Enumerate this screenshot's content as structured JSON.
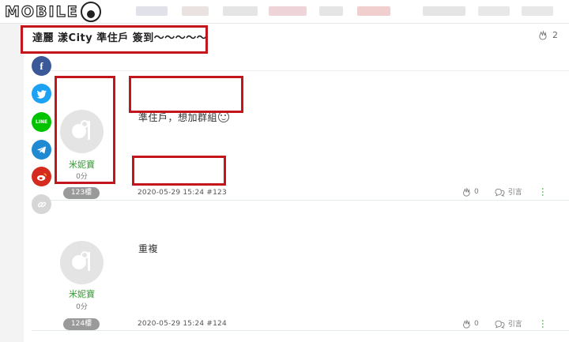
{
  "site": {
    "logo_text": "MOBILE"
  },
  "thread": {
    "title": "達麗 漾City 準住戶 簽到～～～～～",
    "like_count": "2"
  },
  "share_buttons": [
    {
      "name": "facebook",
      "glyph": "f",
      "color": "#3b5998"
    },
    {
      "name": "twitter",
      "glyph": "t",
      "color": "#1da1f2"
    },
    {
      "name": "line",
      "glyph": "LINE",
      "color": "#00c300"
    },
    {
      "name": "telegram",
      "glyph": "➤",
      "color": "#1f8ad1"
    },
    {
      "name": "weibo",
      "glyph": "w",
      "color": "#d52b1e"
    },
    {
      "name": "copy-link",
      "glyph": "∞",
      "color": "#d6d6d6"
    }
  ],
  "posts": [
    {
      "author": "米妮寶",
      "score": "0分",
      "floor": "123樓",
      "content": "準住戶，想加群組",
      "meta": "2020-05-29 15:24 #123",
      "likes": "0",
      "quote_label": "引言"
    },
    {
      "author": "米妮寶",
      "score": "0分",
      "floor": "124樓",
      "content": "重複",
      "meta": "2020-05-29 15:24 #124",
      "likes": "0",
      "quote_label": "引言"
    }
  ]
}
